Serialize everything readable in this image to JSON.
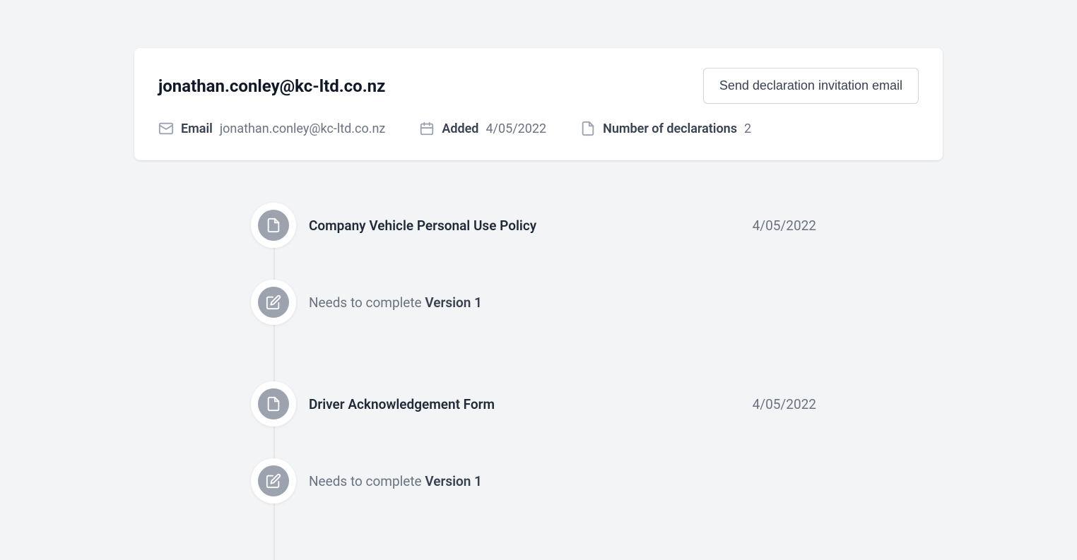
{
  "header": {
    "title": "jonathan.conley@kc-ltd.co.nz",
    "send_button": "Send declaration invitation email",
    "meta": {
      "email_label": "Email",
      "email_value": "jonathan.conley@kc-ltd.co.nz",
      "added_label": "Added",
      "added_value": "4/05/2022",
      "declarations_label": "Number of declarations",
      "declarations_value": "2"
    }
  },
  "timeline": [
    {
      "title": "Company Vehicle Personal Use Policy",
      "date": "4/05/2022",
      "status_prefix": "Needs to complete ",
      "version": "Version 1"
    },
    {
      "title": "Driver Acknowledgement Form",
      "date": "4/05/2022",
      "status_prefix": "Needs to complete ",
      "version": "Version 1"
    }
  ]
}
